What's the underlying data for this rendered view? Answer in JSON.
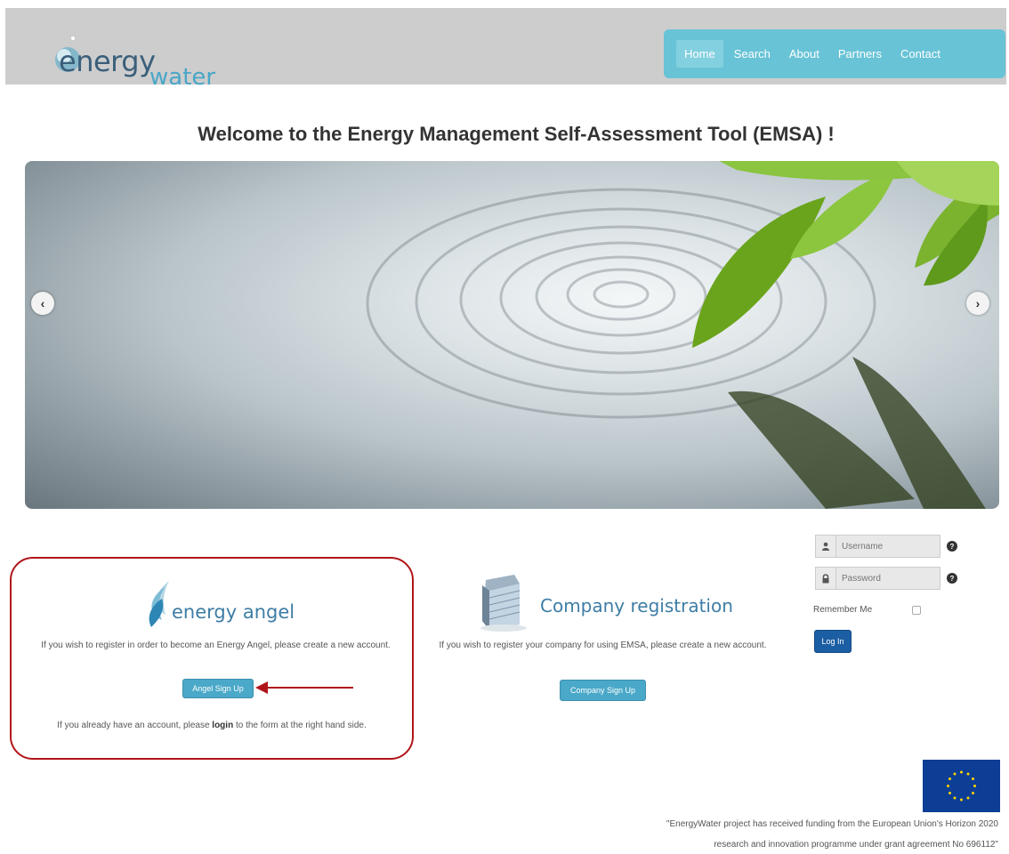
{
  "header": {
    "logo": {
      "part1": "energy",
      "part2": "water"
    },
    "nav": [
      {
        "label": "Home",
        "active": true
      },
      {
        "label": "Search",
        "active": false
      },
      {
        "label": "About",
        "active": false
      },
      {
        "label": "Partners",
        "active": false
      },
      {
        "label": "Contact",
        "active": false
      }
    ]
  },
  "main": {
    "title": "Welcome to the Energy Management Self-Assessment Tool (EMSA) !",
    "carousel": {
      "prev_icon": "chevron-left-icon",
      "next_icon": "chevron-right-icon",
      "prev_glyph": "‹",
      "next_glyph": "›"
    }
  },
  "angel": {
    "logo_text": "energy angel",
    "description": "If you wish to register in order to become an Energy Angel, please create a new account.",
    "button_label": "Angel Sign Up",
    "footer_prefix": "If you already have an account, please ",
    "footer_bold": "login",
    "footer_suffix": " to the form at the right hand side."
  },
  "company": {
    "title": "Company registration",
    "description": "If you wish to register your company for using EMSA, please create a new account.",
    "button_label": "Company Sign Up"
  },
  "login": {
    "username_placeholder": "Username",
    "password_placeholder": "Password",
    "help_glyph": "?",
    "remember_label": "Remember Me",
    "button_label": "Log In"
  },
  "eu": {
    "line1": "\"EnergyWater project has received funding from the European Union's Horizon 2020",
    "line2": "research and innovation programme under grant agreement No 696112\""
  },
  "colors": {
    "nav_bg": "#68c3d6",
    "header_bg": "#cdcdcd",
    "button_blue": "#4aa8c8",
    "login_blue": "#1c5ea3",
    "highlight_red": "#b0141a"
  }
}
